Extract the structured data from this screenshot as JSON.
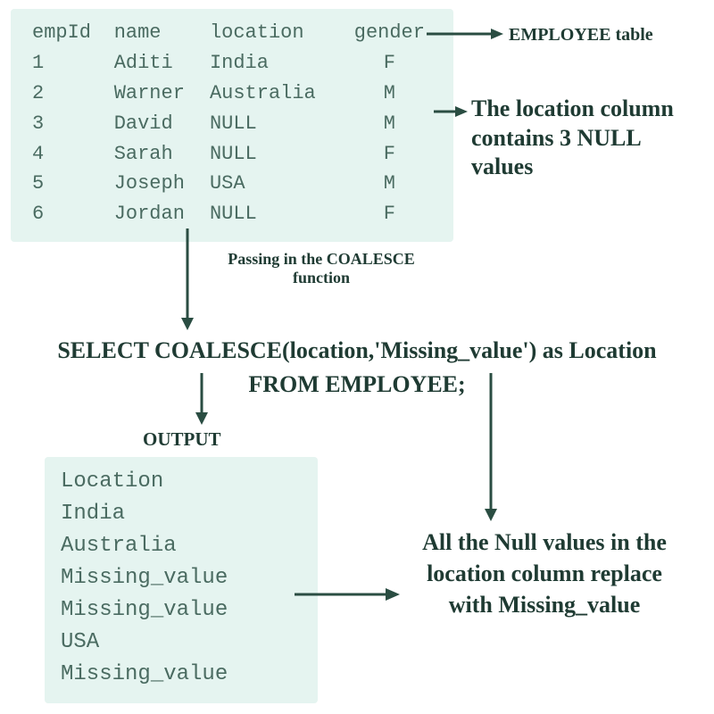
{
  "colors": {
    "panel": "#e5f4f0",
    "ink": "#2a4d42",
    "text": "#4a6b61"
  },
  "employeeTable": {
    "headers": {
      "0": "empId",
      "1": "name",
      "2": "location",
      "3": "gender"
    },
    "rows": {
      "0": {
        "0": "1",
        "1": "Aditi",
        "2": "India",
        "3": "F"
      },
      "1": {
        "0": "2",
        "1": "Warner",
        "2": "Australia",
        "3": "M"
      },
      "2": {
        "0": "3",
        "1": "David",
        "2": "NULL",
        "3": "M"
      },
      "3": {
        "0": "4",
        "1": "Sarah",
        "2": "NULL",
        "3": "F"
      },
      "4": {
        "0": "5",
        "1": "Joseph",
        "2": "USA",
        "3": "M"
      },
      "5": {
        "0": "6",
        "1": "Jordan",
        "2": "NULL",
        "3": "F"
      }
    }
  },
  "annotations": {
    "employeeTableLabel": "EMPLOYEE table",
    "nullAnnotation": "The location column contains 3 NULL values",
    "passing": "Passing in the COALESCE function",
    "outputHeading": "OUTPUT",
    "resultAnnotation": "All the Null values in the location column replace with Missing_value"
  },
  "sql": {
    "line1": "SELECT COALESCE(location,'Missing_value') as Location",
    "line2": "FROM EMPLOYEE;"
  },
  "output": {
    "header": "Location",
    "rows": {
      "0": "India",
      "1": "Australia",
      "2": "Missing_value",
      "3": "Missing_value",
      "4": "USA",
      "5": "Missing_value"
    }
  }
}
